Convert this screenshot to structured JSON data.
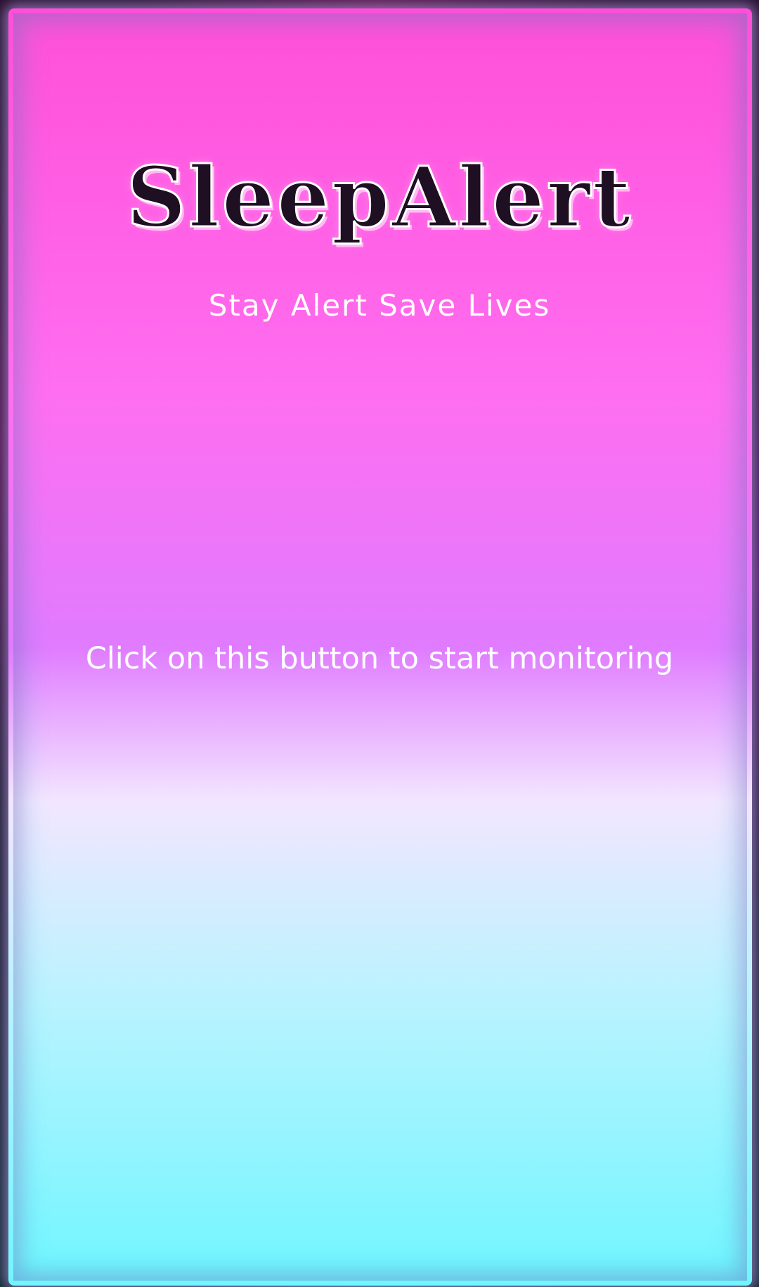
{
  "app": {
    "title": "SleepAlert",
    "tagline": "Stay Alert Save Lives"
  },
  "main": {
    "instruction": "Click on this button to start monitoring"
  },
  "colors": {
    "frame_top": "#ff4fd8",
    "frame_middle": "#e07bff",
    "frame_bottom": "#6ff6ff",
    "background_top": "#2a0f2c",
    "background_bottom": "#10262e",
    "text": "#ffffff"
  }
}
